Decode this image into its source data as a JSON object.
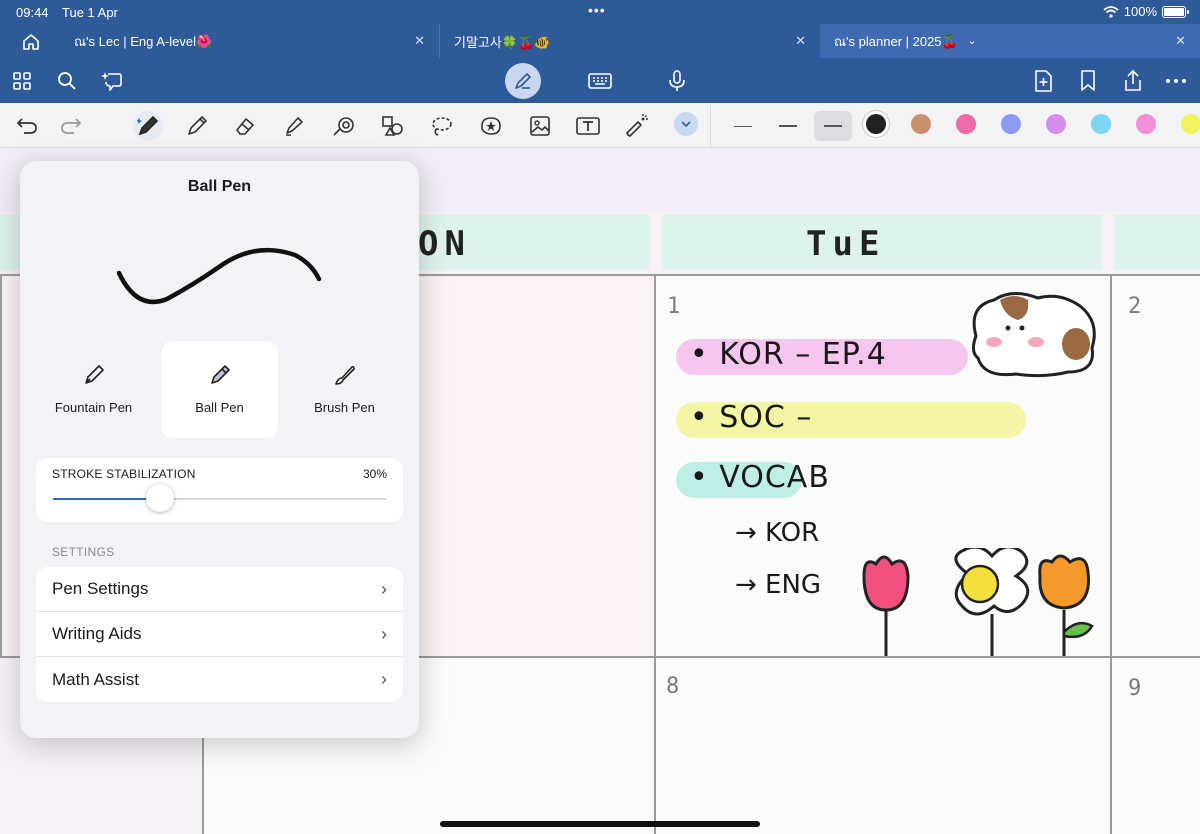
{
  "status": {
    "time": "09:44",
    "date": "Tue 1 Apr",
    "battery": "100%"
  },
  "tabs": [
    {
      "label": "ณ's Lec | Eng A-level🌺"
    },
    {
      "label": "기말고사🍀🍒🐠"
    },
    {
      "label": "ณ's planner | 2025🍒"
    }
  ],
  "colors": {
    "chrome": "#2f5a9a",
    "palette": [
      "#222222",
      "#c8916b",
      "#f06aa6",
      "#8a9df0",
      "#d58ef0",
      "#7fd4f2",
      "#f48ed8",
      "#f4f25c"
    ]
  },
  "planner": {
    "headers": {
      "prev": "ON",
      "current": "TuE"
    },
    "day_numbers": {
      "tue_top": "1",
      "next_top": "2",
      "tue_bottom": "8",
      "next_bottom": "9"
    },
    "notes": [
      "KOR",
      "EP.4",
      "SOC",
      "VOCAB"
    ],
    "sub_notes": [
      "→ KOR",
      "→ ENG"
    ]
  },
  "popover": {
    "title": "Ball Pen",
    "pens": [
      {
        "label": "Fountain Pen",
        "icon": "fountain-pen-icon"
      },
      {
        "label": "Ball Pen",
        "icon": "ball-pen-icon"
      },
      {
        "label": "Brush Pen",
        "icon": "brush-pen-icon"
      }
    ],
    "selected_pen": "Ball Pen",
    "stabilization": {
      "label": "STROKE STABILIZATION",
      "value_text": "30%",
      "value": 0.32
    },
    "settings_label": "SETTINGS",
    "settings": [
      {
        "label": "Pen Settings"
      },
      {
        "label": "Writing Aids"
      },
      {
        "label": "Math Assist"
      }
    ]
  }
}
